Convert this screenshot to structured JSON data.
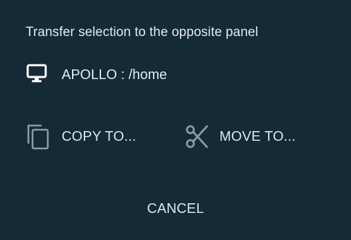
{
  "dialog": {
    "title": "Transfer selection to the opposite panel",
    "target": {
      "icon": "monitor-icon",
      "label": "APOLLO : /home"
    },
    "actions": {
      "copy": {
        "icon": "copy-icon",
        "label": "COPY TO..."
      },
      "move": {
        "icon": "scissors-icon",
        "label": "MOVE TO..."
      }
    },
    "cancel_label": "CANCEL"
  },
  "colors": {
    "background": "#142a36",
    "text": "#e4ebef",
    "icon_muted": "#8d9aa2",
    "icon_bright": "#ffffff"
  }
}
